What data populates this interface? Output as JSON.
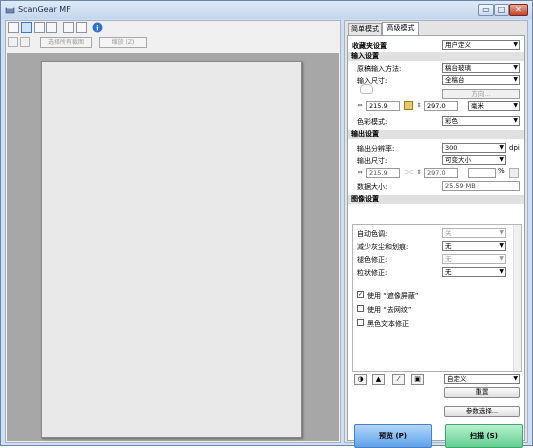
{
  "window": {
    "title": "ScanGear MF",
    "min_glyph": "▭",
    "max_glyph": "□",
    "close_glyph": "✕"
  },
  "toolbar": {
    "select_all_label": "选择所有裁图",
    "zoom_label": "缩放 (Z)"
  },
  "tabs": {
    "simple": "简单模式",
    "advanced": "高级模式"
  },
  "favorites": {
    "label": "收藏夹设置",
    "value": "用户定义"
  },
  "input": {
    "section": "输入设置",
    "method_label": "原稿输入方法:",
    "method_value": "稿台玻璃",
    "size_label": "输入尺寸:",
    "size_value": "全稿台",
    "orientation_label": "方向...",
    "width": "215.9",
    "height": "297.0",
    "unit": "毫米",
    "color_label": "色彩模式:",
    "color_value": "彩色"
  },
  "output": {
    "section": "输出设置",
    "resolution_label": "输出分辨率:",
    "resolution_value": "300",
    "resolution_unit": "dpi",
    "size_label": "输出尺寸:",
    "size_value": "可变大小",
    "width": "215.9",
    "height": "297.0",
    "scale": "%",
    "data_size_label": "数据大小:",
    "data_size_value": "25.59 MB"
  },
  "image": {
    "section": "图像设置",
    "rows": [
      {
        "label": "自动色调:",
        "value": "关",
        "disabled": true
      },
      {
        "label": "减少灰尘和划痕:",
        "value": "无",
        "disabled": false
      },
      {
        "label": "褪色修正:",
        "value": "无",
        "disabled": true
      },
      {
        "label": "粒状修正:",
        "value": "无",
        "disabled": false
      }
    ],
    "checkboxes": [
      {
        "label": "使用 “遮像屏蔽”",
        "checked": true
      },
      {
        "label": "使用 “去网纹”",
        "checked": false
      },
      {
        "label": "黑色文本修正",
        "checked": false
      }
    ]
  },
  "tone": {
    "preset_value": "自定义",
    "reset_label": "重置",
    "prefs_label": "参数选择..."
  },
  "actions": {
    "preview_label": "预览 (P)",
    "scan_label": "扫描 (S)"
  },
  "colors": {
    "preview_button": "#5fa2ea",
    "scan_button": "#62cf92",
    "preview_bg": "#a7a7a7"
  }
}
